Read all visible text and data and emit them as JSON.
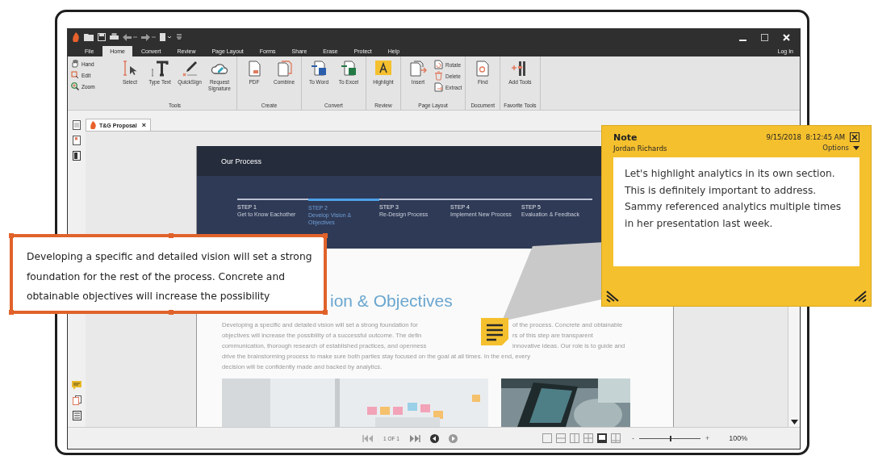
{
  "menu_tabs": [
    {
      "label": "File",
      "selected": false
    },
    {
      "label": "Home",
      "selected": true
    },
    {
      "label": "Convert",
      "selected": false
    },
    {
      "label": "Review",
      "selected": false
    },
    {
      "label": "Page Layout",
      "selected": false
    },
    {
      "label": "Forms",
      "selected": false
    },
    {
      "label": "Share",
      "selected": false
    },
    {
      "label": "Erase",
      "selected": false
    },
    {
      "label": "Protect",
      "selected": false
    },
    {
      "label": "Help",
      "selected": false
    }
  ],
  "login": "Log In",
  "side_tools": [
    {
      "label": "Hand",
      "kind": "hand"
    },
    {
      "label": "Edit",
      "kind": "edit"
    },
    {
      "label": "Zoom",
      "kind": "zoom"
    }
  ],
  "ribbon_groups": [
    {
      "label": "Tools",
      "buttons": [
        {
          "label": "Select",
          "kind": "cursor"
        },
        {
          "label": "Type Text",
          "kind": "text"
        },
        {
          "label": "QuickSign",
          "kind": "pen"
        },
        {
          "label": "Request Signature",
          "kind": "cloud"
        }
      ]
    },
    {
      "label": "Create",
      "buttons": [
        {
          "label": "PDF",
          "kind": "page"
        },
        {
          "label": "Combine",
          "kind": "pages"
        }
      ]
    },
    {
      "label": "Convert",
      "buttons": [
        {
          "label": "To Word",
          "kind": "word"
        },
        {
          "label": "To Excel",
          "kind": "excel"
        }
      ]
    },
    {
      "label": "Review",
      "buttons": [
        {
          "label": "Highlight",
          "kind": "highlight"
        }
      ]
    },
    {
      "label": "Page Layout",
      "buttons": [
        {
          "label": "Insert",
          "kind": "insert"
        }
      ],
      "small_buttons": [
        {
          "label": "Rotate",
          "kind": "rotate"
        },
        {
          "label": "Delete",
          "kind": "delete"
        },
        {
          "label": "Extract",
          "kind": "extract"
        }
      ]
    },
    {
      "label": "Document",
      "buttons": [
        {
          "label": "Find",
          "kind": "find"
        }
      ]
    },
    {
      "label": "Favorite Tools",
      "buttons": [
        {
          "label": "Add Tools",
          "kind": "tools"
        }
      ]
    }
  ],
  "document_tab": {
    "title": "T&G Proposal",
    "close": "×"
  },
  "page": {
    "header": "Our Process",
    "steps": [
      {
        "label": "STEP 1",
        "text": "Get to Know Eachother",
        "selected": false
      },
      {
        "label": "STEP 2",
        "text": "Develop Vision & Objectives",
        "selected": true
      },
      {
        "label": "STEP 3",
        "text": "Re-Design Process",
        "selected": false
      },
      {
        "label": "STEP 4",
        "text": "Implement New Process",
        "selected": false
      },
      {
        "label": "STEP 5",
        "text": "Evaluation & Feedback",
        "selected": false
      }
    ],
    "heading": "ion & Objectives",
    "paragraph_lines": [
      [
        "Developing a specific and detailed vision will set a strong foundation for",
        "of the process. Concrete and obtainable"
      ],
      [
        "objectives will increase the possibility of a successful outcome. The defin",
        "rs of this step are transparent"
      ],
      [
        "communication, thorough research of established practices, and openness",
        "innovative ideas. Our role is to guide and"
      ],
      [
        "drive the brainstorming process to make sure both parties stay focused on the goal at all times. In the end, every"
      ],
      [
        "decision will be confidently made and backed by analytics."
      ]
    ]
  },
  "status_bar": {
    "page_indicator": "1 OF 1",
    "view_modes": [
      {
        "selected": false
      },
      {
        "selected": false
      },
      {
        "selected": false
      },
      {
        "selected": false
      },
      {
        "selected": true
      },
      {
        "selected": false
      }
    ],
    "zoom_minus": "-",
    "zoom_plus": "+",
    "zoom": {
      "level": 0.5
    },
    "zoom_value": "100%"
  },
  "callout": {
    "text": "Developing a specific and detailed vision will set a strong foundation for the rest of the process. Concrete and obtainable objectives will increase the possibility"
  },
  "note": {
    "title": "Note",
    "author": "Jordan Richards",
    "timestamp": "9/15/2018  8:12:45 AM",
    "options": "Options",
    "text": "Let's highlight analytics in its own section. This is definitely important to address. Sammy referenced analytics multiple times in her presentation last week."
  }
}
